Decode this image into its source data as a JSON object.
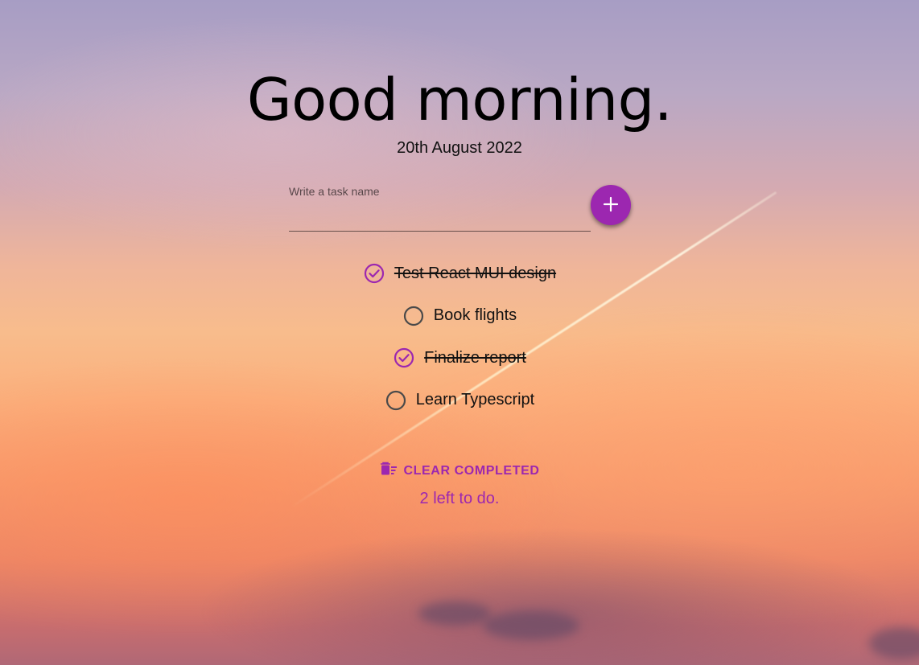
{
  "header": {
    "greeting": "Good morning.",
    "date": "20th August 2022"
  },
  "task_input": {
    "label": "Write a task name",
    "value": ""
  },
  "add_button": {
    "icon": "plus-icon"
  },
  "tasks": [
    {
      "label": "Test React MUI design",
      "completed": true
    },
    {
      "label": "Book flights",
      "completed": false
    },
    {
      "label": "Finalize report",
      "completed": true
    },
    {
      "label": "Learn Typescript",
      "completed": false
    }
  ],
  "footer": {
    "clear_label": "CLEAR COMPLETED",
    "clear_icon": "delete-sweep-icon",
    "left_count": "2 left to do."
  },
  "colors": {
    "accent": "#9c27b0",
    "unchecked": "#4a4a4a"
  }
}
